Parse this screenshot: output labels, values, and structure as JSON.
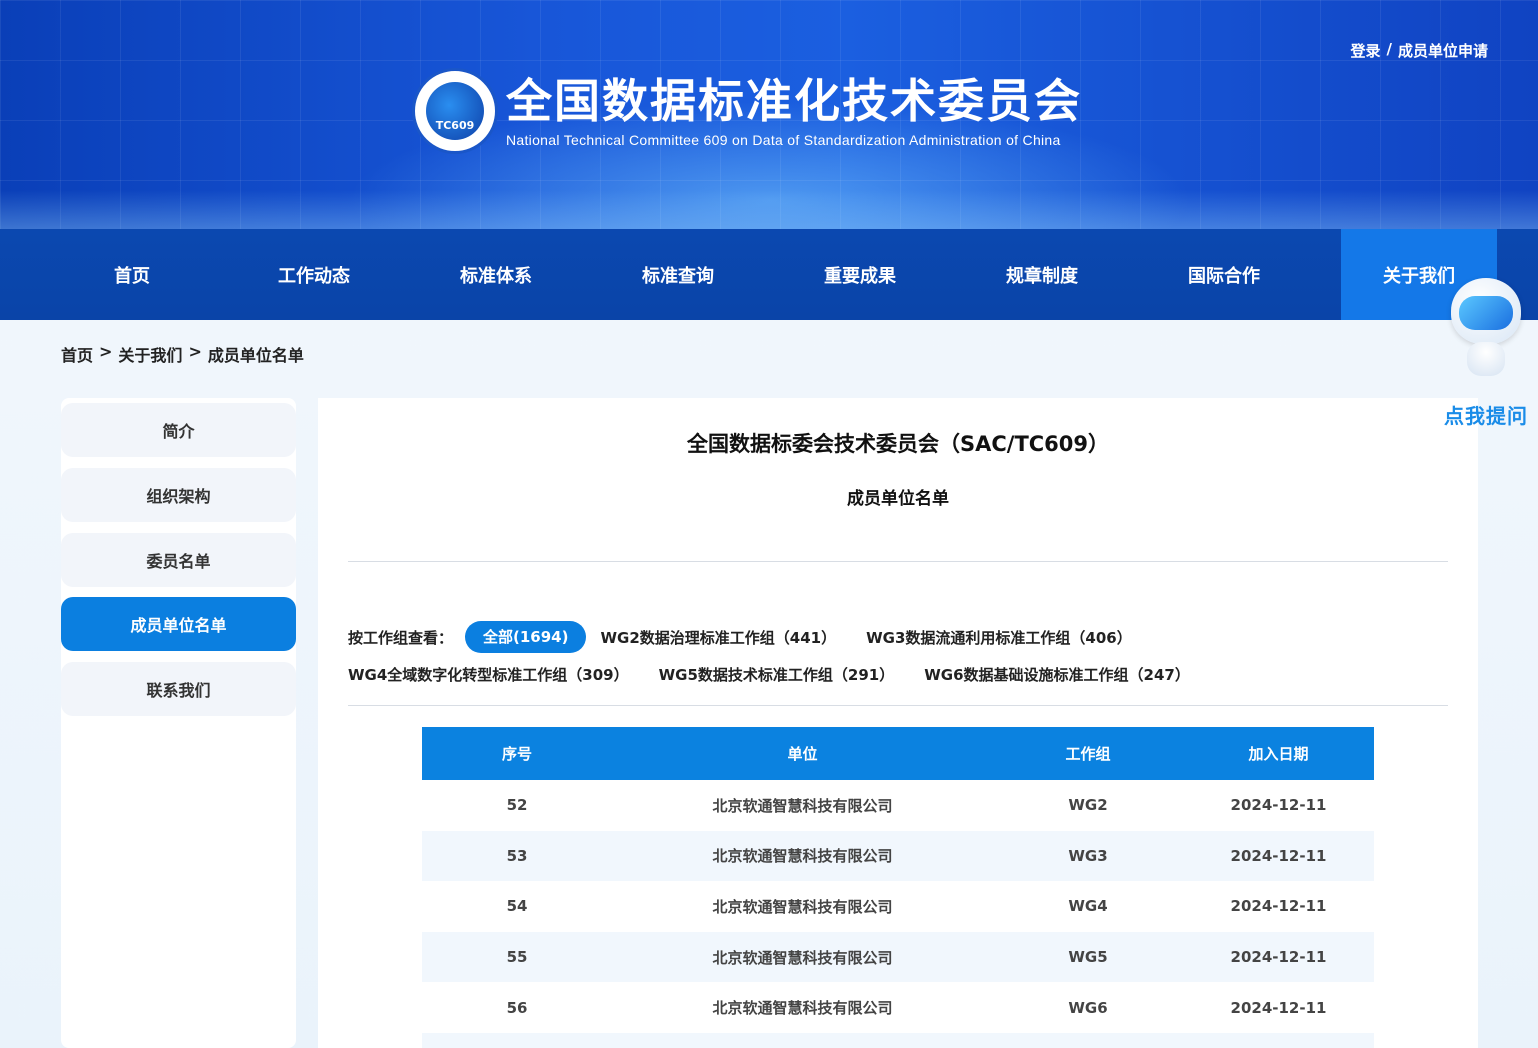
{
  "header": {
    "title_cn": "全国数据标准化技术委员会",
    "title_en": "National Technical Committee 609 on Data of Standardization Administration of China",
    "logo_text": "TC609",
    "login_link": "登录",
    "separator": "/",
    "apply_link": "成员单位申请"
  },
  "nav": {
    "items": [
      {
        "label": "首页"
      },
      {
        "label": "工作动态"
      },
      {
        "label": "标准体系"
      },
      {
        "label": "标准查询"
      },
      {
        "label": "重要成果"
      },
      {
        "label": "规章制度"
      },
      {
        "label": "国际合作"
      },
      {
        "label": "关于我们"
      }
    ],
    "active": "关于我们"
  },
  "breadcrumb": {
    "items": [
      "首页",
      "关于我们",
      "成员单位名单"
    ],
    "separator": ">"
  },
  "sidebar": {
    "items": [
      {
        "label": "简介"
      },
      {
        "label": "组织架构"
      },
      {
        "label": "委员名单"
      },
      {
        "label": "成员单位名单"
      },
      {
        "label": "联系我们"
      }
    ],
    "active": "成员单位名单"
  },
  "main": {
    "title": "全国数据标委会技术委员会（SAC/TC609）",
    "subtitle": "成员单位名单",
    "filter_label": "按工作组查看：",
    "filters": [
      {
        "label": "全部(1694)"
      },
      {
        "label": "WG2数据治理标准工作组（441）"
      },
      {
        "label": "WG3数据流通利用标准工作组（406）"
      },
      {
        "label": "WG4全域数字化转型标准工作组（309）"
      },
      {
        "label": "WG5数据技术标准工作组（291）"
      },
      {
        "label": "WG6数据基础设施标准工作组（247）"
      }
    ],
    "table": {
      "headers": [
        "序号",
        "单位",
        "工作组",
        "加入日期"
      ],
      "rows": [
        {
          "no": "52",
          "unit": "北京软通智慧科技有限公司",
          "group": "WG2",
          "date": "2024-12-11"
        },
        {
          "no": "53",
          "unit": "北京软通智慧科技有限公司",
          "group": "WG3",
          "date": "2024-12-11"
        },
        {
          "no": "54",
          "unit": "北京软通智慧科技有限公司",
          "group": "WG4",
          "date": "2024-12-11"
        },
        {
          "no": "55",
          "unit": "北京软通智慧科技有限公司",
          "group": "WG5",
          "date": "2024-12-11"
        },
        {
          "no": "56",
          "unit": "北京软通智慧科技有限公司",
          "group": "WG6",
          "date": "2024-12-11"
        }
      ]
    }
  },
  "assistant": {
    "label": "点我提问"
  },
  "colors": {
    "nav_bg": "#0a44a8",
    "accent": "#0b7fe0",
    "table_header": "#0b82e0",
    "assistant_text": "#1a8ce8"
  }
}
